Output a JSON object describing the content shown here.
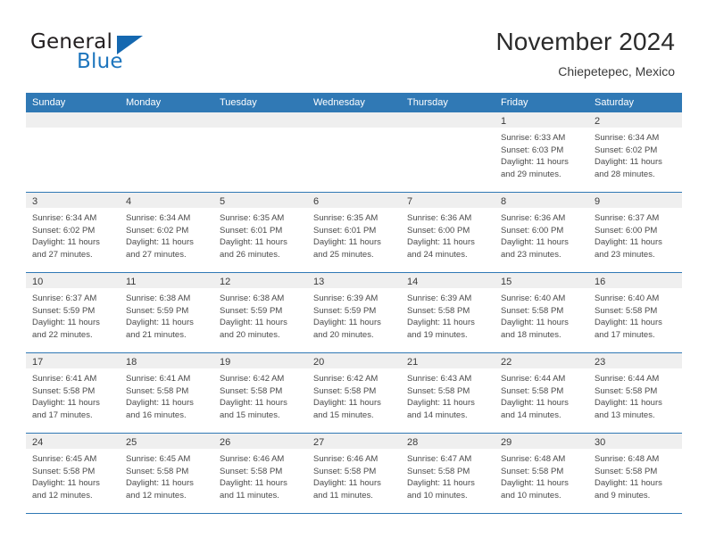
{
  "brand": {
    "name_part1": "General",
    "name_part2": "Blue",
    "logo_icon": "triangle-logo-icon",
    "accent_color": "#1568b0"
  },
  "header": {
    "month_title": "November 2024",
    "location": "Chiepetepec, Mexico"
  },
  "calendar": {
    "header_color": "#3079b5",
    "daynum_strip_color": "#efefef",
    "weekdays": [
      "Sunday",
      "Monday",
      "Tuesday",
      "Wednesday",
      "Thursday",
      "Friday",
      "Saturday"
    ],
    "weeks": [
      [
        {
          "day": "",
          "empty": true,
          "lines": []
        },
        {
          "day": "",
          "empty": true,
          "lines": []
        },
        {
          "day": "",
          "empty": true,
          "lines": []
        },
        {
          "day": "",
          "empty": true,
          "lines": []
        },
        {
          "day": "",
          "empty": true,
          "lines": []
        },
        {
          "day": "1",
          "empty": false,
          "lines": [
            "Sunrise: 6:33 AM",
            "Sunset: 6:03 PM",
            "Daylight: 11 hours",
            "and 29 minutes."
          ]
        },
        {
          "day": "2",
          "empty": false,
          "lines": [
            "Sunrise: 6:34 AM",
            "Sunset: 6:02 PM",
            "Daylight: 11 hours",
            "and 28 minutes."
          ]
        }
      ],
      [
        {
          "day": "3",
          "empty": false,
          "lines": [
            "Sunrise: 6:34 AM",
            "Sunset: 6:02 PM",
            "Daylight: 11 hours",
            "and 27 minutes."
          ]
        },
        {
          "day": "4",
          "empty": false,
          "lines": [
            "Sunrise: 6:34 AM",
            "Sunset: 6:02 PM",
            "Daylight: 11 hours",
            "and 27 minutes."
          ]
        },
        {
          "day": "5",
          "empty": false,
          "lines": [
            "Sunrise: 6:35 AM",
            "Sunset: 6:01 PM",
            "Daylight: 11 hours",
            "and 26 minutes."
          ]
        },
        {
          "day": "6",
          "empty": false,
          "lines": [
            "Sunrise: 6:35 AM",
            "Sunset: 6:01 PM",
            "Daylight: 11 hours",
            "and 25 minutes."
          ]
        },
        {
          "day": "7",
          "empty": false,
          "lines": [
            "Sunrise: 6:36 AM",
            "Sunset: 6:00 PM",
            "Daylight: 11 hours",
            "and 24 minutes."
          ]
        },
        {
          "day": "8",
          "empty": false,
          "lines": [
            "Sunrise: 6:36 AM",
            "Sunset: 6:00 PM",
            "Daylight: 11 hours",
            "and 23 minutes."
          ]
        },
        {
          "day": "9",
          "empty": false,
          "lines": [
            "Sunrise: 6:37 AM",
            "Sunset: 6:00 PM",
            "Daylight: 11 hours",
            "and 23 minutes."
          ]
        }
      ],
      [
        {
          "day": "10",
          "empty": false,
          "lines": [
            "Sunrise: 6:37 AM",
            "Sunset: 5:59 PM",
            "Daylight: 11 hours",
            "and 22 minutes."
          ]
        },
        {
          "day": "11",
          "empty": false,
          "lines": [
            "Sunrise: 6:38 AM",
            "Sunset: 5:59 PM",
            "Daylight: 11 hours",
            "and 21 minutes."
          ]
        },
        {
          "day": "12",
          "empty": false,
          "lines": [
            "Sunrise: 6:38 AM",
            "Sunset: 5:59 PM",
            "Daylight: 11 hours",
            "and 20 minutes."
          ]
        },
        {
          "day": "13",
          "empty": false,
          "lines": [
            "Sunrise: 6:39 AM",
            "Sunset: 5:59 PM",
            "Daylight: 11 hours",
            "and 20 minutes."
          ]
        },
        {
          "day": "14",
          "empty": false,
          "lines": [
            "Sunrise: 6:39 AM",
            "Sunset: 5:58 PM",
            "Daylight: 11 hours",
            "and 19 minutes."
          ]
        },
        {
          "day": "15",
          "empty": false,
          "lines": [
            "Sunrise: 6:40 AM",
            "Sunset: 5:58 PM",
            "Daylight: 11 hours",
            "and 18 minutes."
          ]
        },
        {
          "day": "16",
          "empty": false,
          "lines": [
            "Sunrise: 6:40 AM",
            "Sunset: 5:58 PM",
            "Daylight: 11 hours",
            "and 17 minutes."
          ]
        }
      ],
      [
        {
          "day": "17",
          "empty": false,
          "lines": [
            "Sunrise: 6:41 AM",
            "Sunset: 5:58 PM",
            "Daylight: 11 hours",
            "and 17 minutes."
          ]
        },
        {
          "day": "18",
          "empty": false,
          "lines": [
            "Sunrise: 6:41 AM",
            "Sunset: 5:58 PM",
            "Daylight: 11 hours",
            "and 16 minutes."
          ]
        },
        {
          "day": "19",
          "empty": false,
          "lines": [
            "Sunrise: 6:42 AM",
            "Sunset: 5:58 PM",
            "Daylight: 11 hours",
            "and 15 minutes."
          ]
        },
        {
          "day": "20",
          "empty": false,
          "lines": [
            "Sunrise: 6:42 AM",
            "Sunset: 5:58 PM",
            "Daylight: 11 hours",
            "and 15 minutes."
          ]
        },
        {
          "day": "21",
          "empty": false,
          "lines": [
            "Sunrise: 6:43 AM",
            "Sunset: 5:58 PM",
            "Daylight: 11 hours",
            "and 14 minutes."
          ]
        },
        {
          "day": "22",
          "empty": false,
          "lines": [
            "Sunrise: 6:44 AM",
            "Sunset: 5:58 PM",
            "Daylight: 11 hours",
            "and 14 minutes."
          ]
        },
        {
          "day": "23",
          "empty": false,
          "lines": [
            "Sunrise: 6:44 AM",
            "Sunset: 5:58 PM",
            "Daylight: 11 hours",
            "and 13 minutes."
          ]
        }
      ],
      [
        {
          "day": "24",
          "empty": false,
          "lines": [
            "Sunrise: 6:45 AM",
            "Sunset: 5:58 PM",
            "Daylight: 11 hours",
            "and 12 minutes."
          ]
        },
        {
          "day": "25",
          "empty": false,
          "lines": [
            "Sunrise: 6:45 AM",
            "Sunset: 5:58 PM",
            "Daylight: 11 hours",
            "and 12 minutes."
          ]
        },
        {
          "day": "26",
          "empty": false,
          "lines": [
            "Sunrise: 6:46 AM",
            "Sunset: 5:58 PM",
            "Daylight: 11 hours",
            "and 11 minutes."
          ]
        },
        {
          "day": "27",
          "empty": false,
          "lines": [
            "Sunrise: 6:46 AM",
            "Sunset: 5:58 PM",
            "Daylight: 11 hours",
            "and 11 minutes."
          ]
        },
        {
          "day": "28",
          "empty": false,
          "lines": [
            "Sunrise: 6:47 AM",
            "Sunset: 5:58 PM",
            "Daylight: 11 hours",
            "and 10 minutes."
          ]
        },
        {
          "day": "29",
          "empty": false,
          "lines": [
            "Sunrise: 6:48 AM",
            "Sunset: 5:58 PM",
            "Daylight: 11 hours",
            "and 10 minutes."
          ]
        },
        {
          "day": "30",
          "empty": false,
          "lines": [
            "Sunrise: 6:48 AM",
            "Sunset: 5:58 PM",
            "Daylight: 11 hours",
            "and 9 minutes."
          ]
        }
      ]
    ]
  }
}
